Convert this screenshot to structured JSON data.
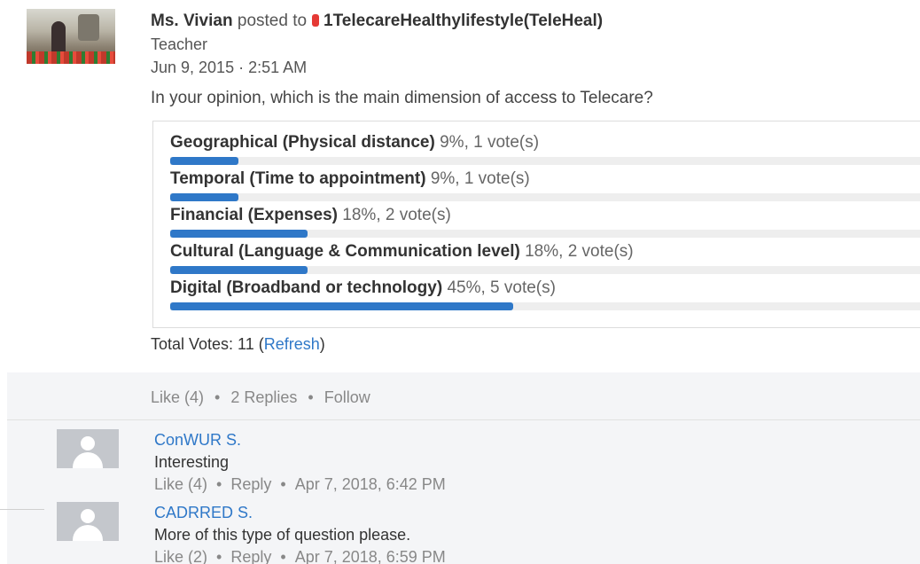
{
  "post": {
    "author": "Ms. Vivian",
    "posted_to_text": "posted to",
    "group": "1TelecareHealthylifestyle(TeleHeal)",
    "role": "Teacher",
    "timestamp": "Jun 9, 2015 · 2:51 AM",
    "question": "In your opinion, which is the main dimension of access to Telecare?"
  },
  "poll": {
    "options": [
      {
        "label": "Geographical (Physical distance)",
        "stats": "9%, 1 vote(s)",
        "percent": 9
      },
      {
        "label": "Temporal (Time to appointment)",
        "stats": "9%, 1 vote(s)",
        "percent": 9
      },
      {
        "label": "Financial (Expenses)",
        "stats": "18%, 2 vote(s)",
        "percent": 18
      },
      {
        "label": "Cultural (Language & Communication level)",
        "stats": "18%, 2 vote(s)",
        "percent": 18
      },
      {
        "label": "Digital (Broadband or technology)",
        "stats": "45%, 5 vote(s)",
        "percent": 45
      }
    ],
    "total_label": "Total Votes: 11",
    "refresh_open": "(",
    "refresh_label": "Refresh",
    "refresh_close": ")",
    "fill_color": "#2f78c8"
  },
  "actions": {
    "like": "Like (4)",
    "replies": "2 Replies",
    "follow": "Follow",
    "separator": "•"
  },
  "comments": [
    {
      "author": "ConWUR S.",
      "text": "Interesting",
      "like": "Like (4)",
      "reply": "Reply",
      "date": "Apr 7, 2018, 6:42 PM",
      "avatar_icon": "default-user-icon"
    },
    {
      "author": "CADRRED S.",
      "text": "More of this type of question please.",
      "like": "Like (2)",
      "reply": "Reply",
      "date": "Apr 7, 2018, 6:59 PM",
      "avatar_icon": "default-user-icon"
    }
  ]
}
